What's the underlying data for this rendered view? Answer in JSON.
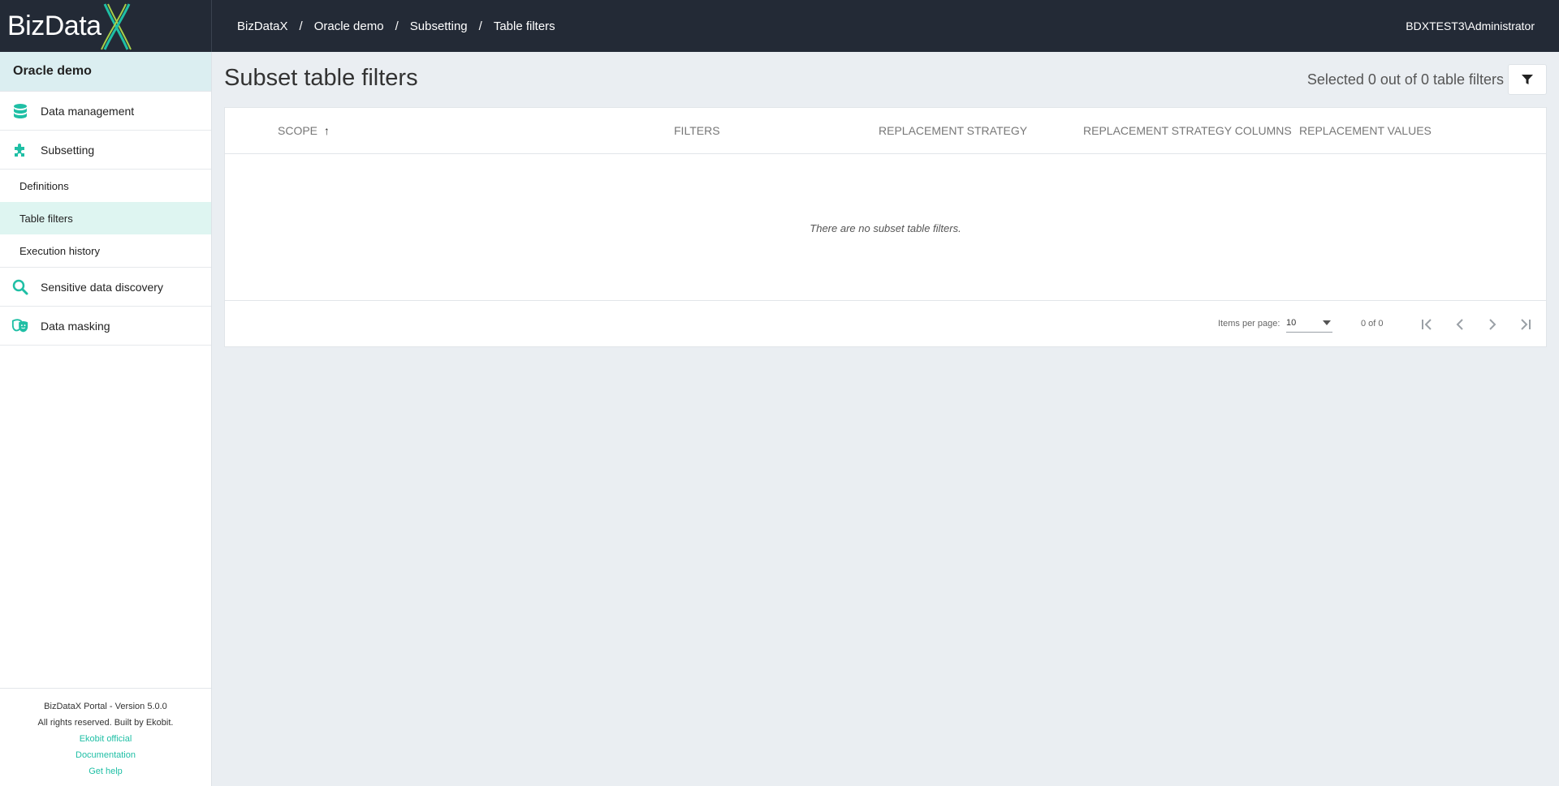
{
  "app": {
    "logo_text": "BizData",
    "user": "BDXTEST3\\Administrator"
  },
  "breadcrumb": [
    "BizDataX",
    "Oracle demo",
    "Subsetting",
    "Table filters"
  ],
  "sidebar": {
    "project": "Oracle demo",
    "items": [
      {
        "label": "Data management",
        "icon": "database-icon"
      },
      {
        "label": "Subsetting",
        "icon": "puzzle-icon"
      },
      {
        "label": "Sensitive data discovery",
        "icon": "search-icon"
      },
      {
        "label": "Data masking",
        "icon": "masks-icon"
      }
    ],
    "subitems": [
      "Definitions",
      "Table filters",
      "Execution history"
    ],
    "footer": {
      "version": "BizDataX Portal - Version 5.0.0",
      "rights": "All rights reserved. Built by Ekobit.",
      "links": [
        "Ekobit official",
        "Documentation",
        "Get help"
      ]
    }
  },
  "main": {
    "title": "Subset table filters",
    "selected_info": "Selected 0 out of 0 table filters",
    "columns": [
      "SCOPE",
      "FILTERS",
      "REPLACEMENT STRATEGY",
      "REPLACEMENT STRATEGY COLUMNS",
      "REPLACEMENT VALUES"
    ],
    "sort_indicator": "↑",
    "empty_message": "There are no subset table filters.",
    "paginator": {
      "items_per_page_label": "Items per page:",
      "items_per_page": "10",
      "range": "0 of 0"
    }
  },
  "colors": {
    "topbar": "#232a36",
    "accent": "#1fbfa5",
    "active_bg": "#def5f1"
  }
}
